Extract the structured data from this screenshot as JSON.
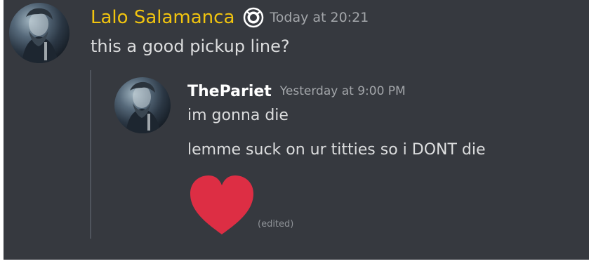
{
  "message": {
    "author": "Lalo Salamanca",
    "author_color": "#f1c40f",
    "badge_icon": "nitro-badge-icon",
    "timestamp": "Today at 20:21",
    "text": "this a good pickup line?"
  },
  "quoted": {
    "author": "ThePariet",
    "timestamp": "Yesterday at 9:00 PM",
    "lines": [
      "im gonna die",
      "lemme suck on ur titties so i DONT die"
    ],
    "emoji": "heart-emoji",
    "heart_color": "#dd2e44",
    "edited_label": "(edited)"
  }
}
